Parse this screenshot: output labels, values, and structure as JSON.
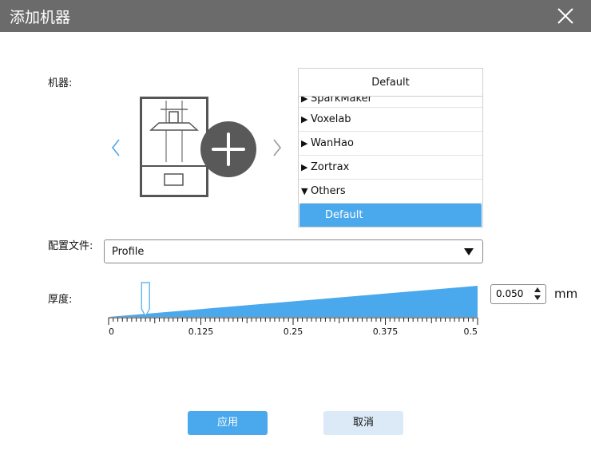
{
  "dialog": {
    "title": "添加机器",
    "close_icon": "close-icon"
  },
  "machine": {
    "label": "机器:",
    "prev_icon": "chevron-left-icon",
    "next_icon": "chevron-right-icon",
    "add_icon": "plus-icon",
    "printer_icon": "printer-icon"
  },
  "list": {
    "header": "Default",
    "partial_item": "SparkMaker",
    "items": [
      {
        "label": "Voxelab",
        "expanded": false
      },
      {
        "label": "WanHao",
        "expanded": false
      },
      {
        "label": "Zortrax",
        "expanded": false
      },
      {
        "label": "Others",
        "expanded": true
      }
    ],
    "selected_child": "Default",
    "collapsed_glyph": "▶",
    "expanded_glyph": "▼"
  },
  "profile": {
    "label": "配置文件:",
    "value": "Profile"
  },
  "thickness": {
    "label": "厚度:",
    "value": "0.050",
    "unit": "mm",
    "min": 0,
    "max": 0.5,
    "current": 0.05,
    "ticks": [
      "0",
      "0.125",
      "0.25",
      "0.375",
      "0.5"
    ]
  },
  "buttons": {
    "apply": "应用",
    "cancel": "取消"
  },
  "colors": {
    "accent": "#4aa8ec",
    "titlebar": "#6b6b6b",
    "cancel_bg": "#dceaf8"
  }
}
